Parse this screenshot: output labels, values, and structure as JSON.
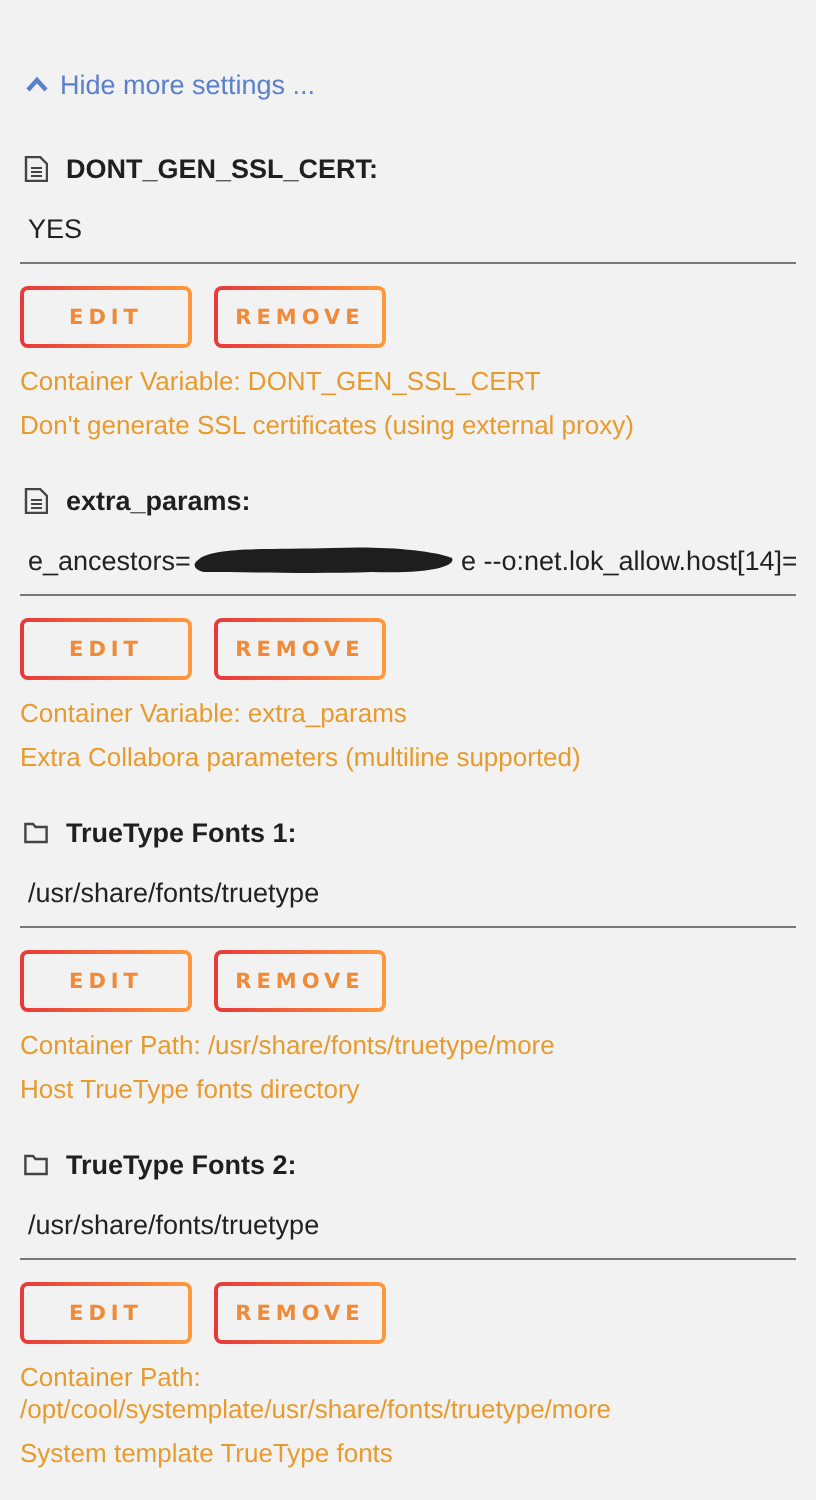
{
  "toggle_link": {
    "label": "Hide more settings ...",
    "expanded": true
  },
  "settings": [
    {
      "kind": "variable",
      "label": "DONT_GEN_SSL_CERT:",
      "value_segments": [
        {
          "kind": "text",
          "text": "YES"
        }
      ],
      "buttons": [
        "EDIT",
        "REMOVE"
      ],
      "notes": [
        "Container Variable: DONT_GEN_SSL_CERT",
        "Don't generate SSL certificates (using external proxy)"
      ]
    },
    {
      "kind": "variable",
      "label": "extra_params:",
      "value_segments": [
        {
          "kind": "text",
          "text": "e_ancestors="
        },
        {
          "kind": "redaction"
        },
        {
          "kind": "text",
          "text": "e --o:net.lok_allow.host[14]="
        }
      ],
      "buttons": [
        "EDIT",
        "REMOVE"
      ],
      "notes": [
        "Container Variable: extra_params",
        "Extra Collabora parameters (multiline supported)"
      ]
    },
    {
      "kind": "path",
      "label": "TrueType Fonts 1:",
      "value_segments": [
        {
          "kind": "text",
          "text": "/usr/share/fonts/truetype"
        }
      ],
      "buttons": [
        "EDIT",
        "REMOVE"
      ],
      "notes": [
        "Container Path: /usr/share/fonts/truetype/more",
        "Host TrueType fonts directory"
      ]
    },
    {
      "kind": "path",
      "label": "TrueType Fonts 2:",
      "value_segments": [
        {
          "kind": "text",
          "text": "/usr/share/fonts/truetype"
        }
      ],
      "buttons": [
        "EDIT",
        "REMOVE"
      ],
      "notes": [
        "Container Path: /opt/cool/systemplate/usr/share/fonts/truetype/more",
        "System template TrueType fonts"
      ]
    }
  ]
}
